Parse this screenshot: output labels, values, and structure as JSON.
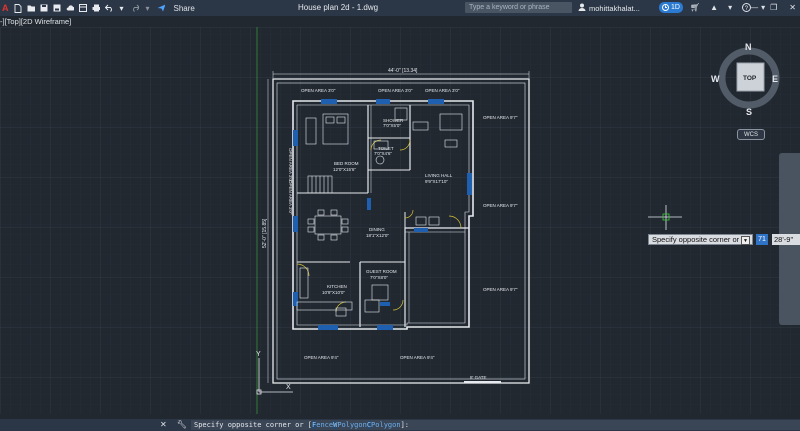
{
  "titlebar": {
    "app_logo": "A",
    "share_label": "Share",
    "document_title": "House plan 2d - 1.dwg",
    "search_placeholder": "Type a keyword or phrase",
    "user_name": "mohittakhalat...",
    "clock_badge": "1D"
  },
  "viewport": {
    "label": "-][Top][2D Wireframe]"
  },
  "viewcube": {
    "top": "TOP",
    "north": "N",
    "south": "S",
    "east": "E",
    "west": "W",
    "wcs": "WCS"
  },
  "drawing": {
    "width_dim": "44'-0\" [13.34]",
    "height_dim": "52'-0\" [15.85]",
    "open_areas": {
      "top_left": "OPEN AREA 3'0\"",
      "top_mid": "OPEN AREA 3'0\"",
      "top_right": "OPEN AREA 3'0\"",
      "left_upper": "OPEN AREA 3'0\"",
      "left_lower": "OPEN AREA 3'0\"",
      "right_1": "OPEN AREA 9'7\"",
      "right_2": "OPEN AREA 9'7\"",
      "right_3": "OPEN AREA 9'7\"",
      "bottom_left": "OPEN AREA 9'4\"",
      "bottom_right": "OPEN AREA 9'4\""
    },
    "rooms": {
      "shower": "SHOWER",
      "shower_size": "7'0\"X5'0\"",
      "toilet": "TOILET",
      "toilet_size": "7'0\"X4'6\"",
      "bedroom": "BED ROOM",
      "bedroom_size": "12'0\"X15'6\"",
      "living": "LIVING HALL",
      "living_size": "9'9\"X17'10\"",
      "dining": "DINING",
      "dining_size": "18'1\"X12'0\"",
      "guest": "GUEST ROOM",
      "guest_size": "7'0\"X8'0\"",
      "kitchen": "KITCHEN",
      "kitchen_size": "10'9\"X10'0\""
    },
    "gate": "8' GATE",
    "ucs_y": "Y",
    "ucs_x": "X"
  },
  "cursor": {
    "tooltip": "Specify opposite corner or",
    "input_1": "71",
    "input_2": "28'-9\""
  },
  "command_line": {
    "prefix": "Specify opposite corner or [",
    "fence_key": "F",
    "fence_rest": "ence ",
    "wpoly_key": "W",
    "wpoly_rest": "Polygon ",
    "cpoly_key": "C",
    "cpoly_rest": "Polygon",
    "suffix": "]:"
  }
}
